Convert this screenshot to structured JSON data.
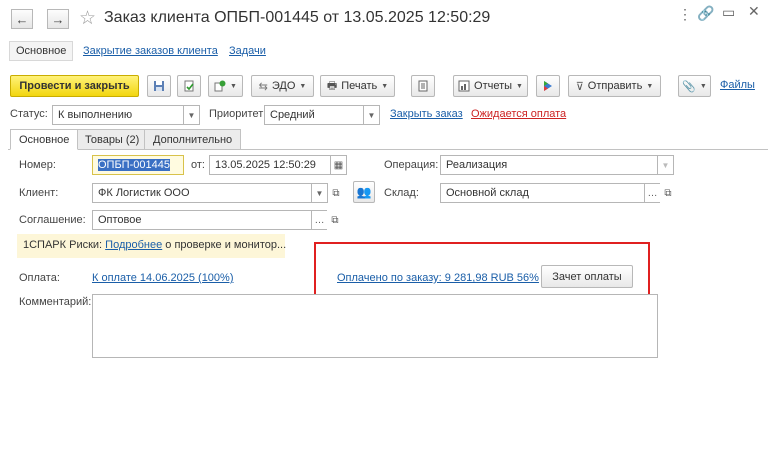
{
  "window": {
    "title": "Заказ клиента ОПБП-001445 от 13.05.2025 12:50:29"
  },
  "nav": {
    "back": "←",
    "forward": "→",
    "items": [
      "Основное",
      "Закрытие заказов клиента",
      "Задачи"
    ]
  },
  "toolbar": {
    "post_close": "Провести и закрыть",
    "edo": "ЭДО",
    "print": "Печать",
    "reports": "Отчеты",
    "send": "Отправить",
    "files": "Файлы"
  },
  "status_bar": {
    "status_label": "Статус:",
    "status_value": "К выполнению",
    "priority_label": "Приоритет:",
    "priority_value": "Средний",
    "close_order": "Закрыть заказ",
    "awaiting_payment": "Ожидается оплата"
  },
  "tabs": [
    "Основное",
    "Товары (2)",
    "Дополнительно"
  ],
  "form": {
    "number_label": "Номер:",
    "number_value": "ОПБП-001445",
    "from_label": "от:",
    "date_value": "13.05.2025 12:50:29",
    "operation_label": "Операция:",
    "operation_value": "Реализация",
    "client_label": "Клиент:",
    "client_value": "ФК Логистик ООО",
    "warehouse_label": "Склад:",
    "warehouse_value": "Основной склад",
    "agreement_label": "Соглашение:",
    "agreement_value": "Оптовое",
    "spark_prefix": "1СПАРК Риски:",
    "spark_link": "Подробнее",
    "spark_suffix": "о проверке и монитор...",
    "payment_label": "Оплата:",
    "payment_link": "К оплате 14.06.2025 (100%)",
    "paid_link": "Оплачено по заказу: 9 281,98 RUB 56%",
    "offset_button": "Зачет оплаты",
    "comment_label": "Комментарий:",
    "comment_value": ""
  },
  "colors": {
    "primary_button": "#f2d60f",
    "link": "#1a5ea8",
    "warning_link": "#cc2222",
    "highlight_box": "#e02020",
    "selection": "#3a6fc4"
  }
}
